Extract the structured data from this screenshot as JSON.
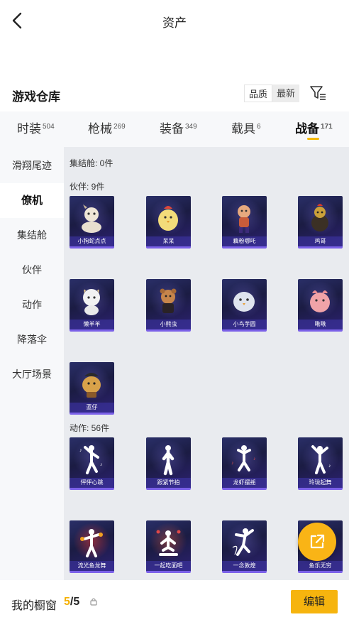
{
  "header": {
    "title": "资产",
    "back_icon": "back-arrow-icon"
  },
  "warehouse": {
    "title": "游戏仓库",
    "sort_quality": "品质",
    "sort_newest": "最新",
    "filter_icon": "filter-icon"
  },
  "tabs": [
    {
      "label": "时装",
      "count": "504"
    },
    {
      "label": "枪械",
      "count": "269"
    },
    {
      "label": "装备",
      "count": "349"
    },
    {
      "label": "载具",
      "count": "6"
    },
    {
      "label": "战备",
      "count": "171"
    }
  ],
  "sidebar": {
    "items": [
      {
        "label": "滑翔尾迹"
      },
      {
        "label": "僚机"
      },
      {
        "label": "集结舱"
      },
      {
        "label": "伙伴"
      },
      {
        "label": "动作"
      },
      {
        "label": "降落伞"
      },
      {
        "label": "大厅场景"
      }
    ]
  },
  "sections": {
    "capsule": {
      "label": "集结舱: 0件"
    },
    "partners": {
      "label": "伙伴: 9件",
      "items": [
        {
          "name": "小狗蛇点点"
        },
        {
          "name": "呆呆"
        },
        {
          "name": "藕粉哪吒"
        },
        {
          "name": "鸡哥"
        },
        {
          "name": "懒羊羊"
        },
        {
          "name": "小熊虫"
        },
        {
          "name": "小鸟芋圆"
        },
        {
          "name": "啾啾"
        },
        {
          "name": "蓝仔"
        }
      ]
    },
    "emotes": {
      "label": "动作: 56件",
      "items": [
        {
          "name": "怦怦心跳"
        },
        {
          "name": "跟紧节拍"
        },
        {
          "name": "龙虾摆摇"
        },
        {
          "name": "玲珑起舞"
        },
        {
          "name": "流光鱼龙舞"
        },
        {
          "name": "一起吃面吧"
        },
        {
          "name": "一念敦煌"
        },
        {
          "name": "鱼乐无穷"
        }
      ]
    }
  },
  "fab": {
    "icon": "share-external-icon"
  },
  "bottom": {
    "label": "我的橱窗",
    "current": "5",
    "separator": "/",
    "total": "5",
    "lock_icon": "lock-icon",
    "edit_label": "编辑"
  },
  "colors": {
    "accent": "#f6b40e",
    "card_bg": "#1b1c43",
    "card_border": "#7b61e8",
    "content_bg": "#e9ebef",
    "sidebar_bg": "#f7f8fa"
  }
}
